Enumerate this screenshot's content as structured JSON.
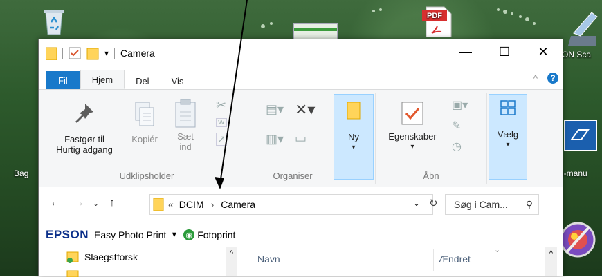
{
  "desktop": {
    "icons": [
      {
        "label": "Bag"
      },
      {
        "label": "ON Sca"
      },
      {
        "label": "N-manu"
      }
    ],
    "pdf_badge": "PDF"
  },
  "window": {
    "title": "Camera",
    "controls": {
      "minimize": "—",
      "maximize": "☐",
      "close": "✕"
    }
  },
  "ribbon_tabs": {
    "file": "Fil",
    "home": "Hjem",
    "share": "Del",
    "view": "Vis"
  },
  "ribbon": {
    "pin_line1": "Fastgør til",
    "pin_line2": "Hurtig adgang",
    "copy": "Kopiér",
    "paste_line1": "Sæt",
    "paste_line2": "ind",
    "clipboard_group": "Udklipsholder",
    "organize_group": "Organiser",
    "new": "Ny",
    "properties": "Egenskaber",
    "open_group": "Åbn",
    "select": "Vælg"
  },
  "address": {
    "prefix": "«",
    "segment1": "DCIM",
    "chevron": "›",
    "segment2": "Camera",
    "search_placeholder": "Søg i Cam..."
  },
  "epson_toolbar": {
    "brand": "EPSON",
    "easy_photo_print": "Easy Photo Print",
    "fotoprint": "Fotoprint"
  },
  "navigation_pane": {
    "items": [
      {
        "label": "Slaegstforsk"
      }
    ]
  },
  "file_list": {
    "columns": {
      "name": "Navn",
      "modified": "Ændret"
    }
  }
}
